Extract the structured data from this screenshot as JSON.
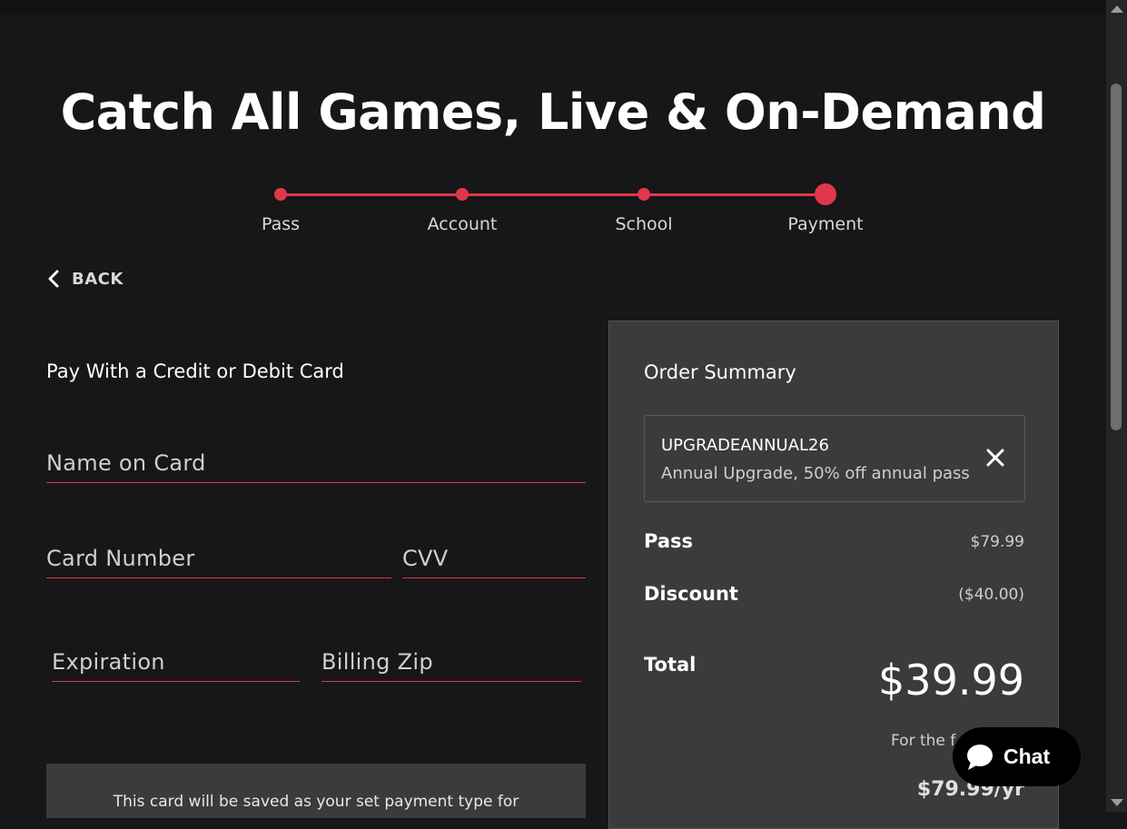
{
  "page": {
    "title": "Catch All Games, Live & On-Demand"
  },
  "stepper": {
    "steps": [
      {
        "label": "Pass"
      },
      {
        "label": "Account"
      },
      {
        "label": "School"
      },
      {
        "label": "Payment"
      }
    ],
    "current_step": "Payment",
    "accent": "#e0384a"
  },
  "nav": {
    "back_label": "BACK",
    "back_icon": "chevron-left-icon"
  },
  "payment_form": {
    "title": "Pay With a Credit or Debit Card",
    "name_placeholder": "Name on Card",
    "card_number_placeholder": "Card Number",
    "cvv_placeholder": "CVV",
    "expiration_placeholder": "Expiration",
    "zip_placeholder": "Billing Zip",
    "note": "This card will be saved as your set payment type for"
  },
  "order_summary": {
    "title": "Order Summary",
    "promo": {
      "code": "UPGRADEANNUAL26",
      "description": "Annual Upgrade, 50% off annual pass",
      "remove_icon": "close-icon"
    },
    "pass_label": "Pass",
    "pass_value": "$79.99",
    "discount_label": "Discount",
    "discount_value": "($40.00)",
    "total_label": "Total",
    "total_value": "$39.99",
    "for_first_text": "For the f",
    "renewal_price": "$79.99/yr"
  },
  "chat": {
    "label": "Chat",
    "icon": "chat-bubble-icon"
  },
  "colors": {
    "background": "#171618",
    "panel": "#3b3a3c",
    "accent": "#e0384a"
  }
}
